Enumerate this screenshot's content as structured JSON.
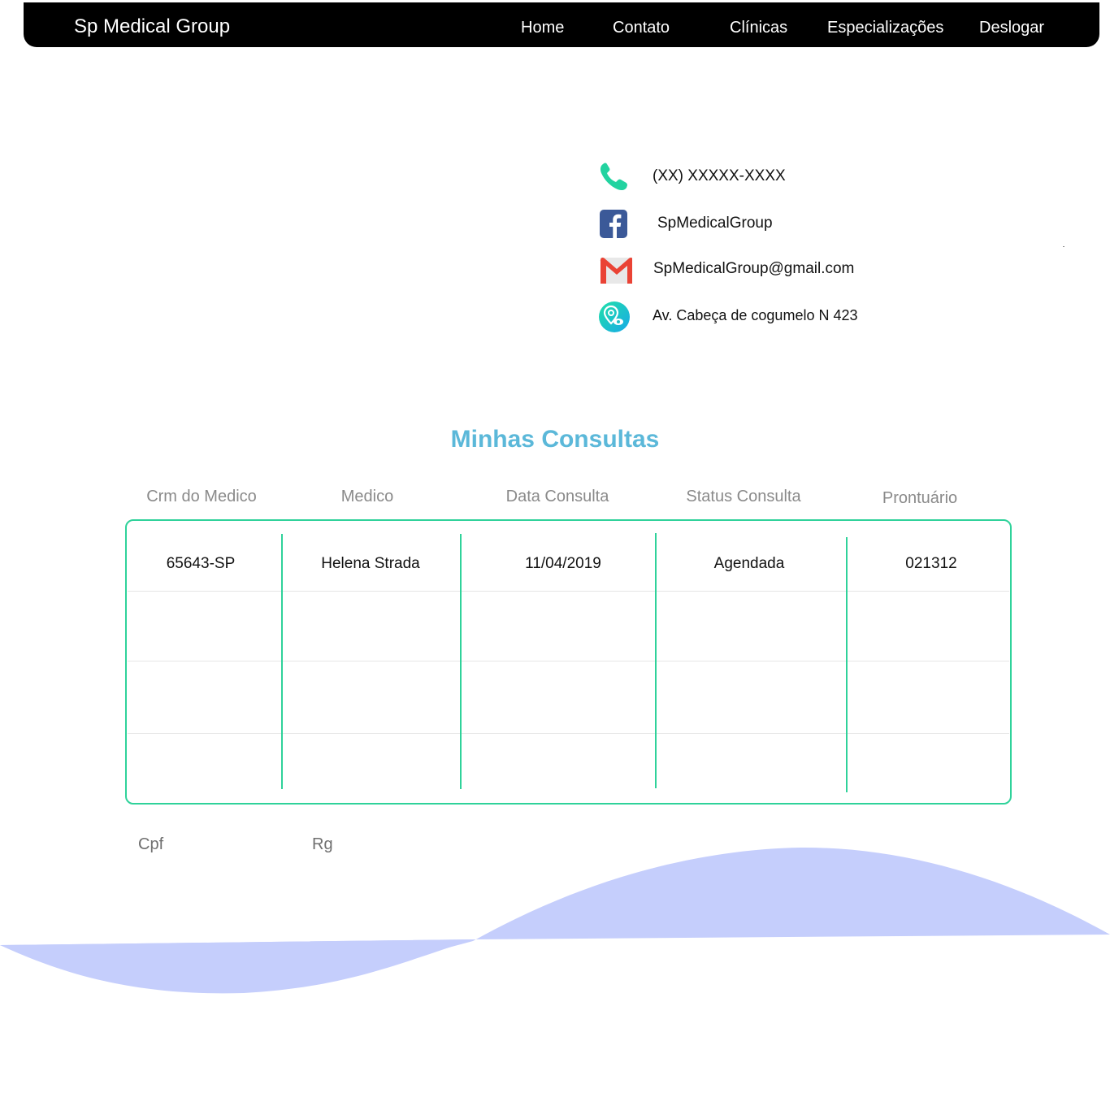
{
  "navbar": {
    "brand": "Sp Medical Group",
    "links": [
      {
        "label": "Home"
      },
      {
        "label": "Contato"
      },
      {
        "label": "Clínicas"
      },
      {
        "label": "Especializações"
      },
      {
        "label": "Deslogar"
      }
    ]
  },
  "contact": {
    "phone": "(XX) XXXXX-XXXX",
    "facebook": "SpMedicalGroup",
    "email": "SpMedicalGroup@gmail.com",
    "address": "Av. Cabeça de cogumelo N 423",
    "icons": [
      "phone-icon",
      "facebook-icon",
      "gmail-icon",
      "location-icon"
    ]
  },
  "consultas": {
    "title": "Minhas Consultas",
    "headers": [
      "Crm do Medico",
      "Medico",
      "Data Consulta",
      "Status Consulta",
      "Prontuário"
    ],
    "rows": [
      [
        "65643-SP",
        "Helena Strada",
        "11/04/2019",
        "Agendada",
        "021312"
      ]
    ]
  },
  "user_fields": {
    "cpf_label": "Cpf",
    "rg_label": "Rg"
  },
  "colors": {
    "navbar_bg": "#000000",
    "accent_title": "#5bb8d9",
    "table_border": "#2fd29a",
    "wave": "#c5cefc",
    "phone_icon": "#22d3a0",
    "facebook_icon": "#3b5998",
    "gmail_red": "#ea4335"
  }
}
